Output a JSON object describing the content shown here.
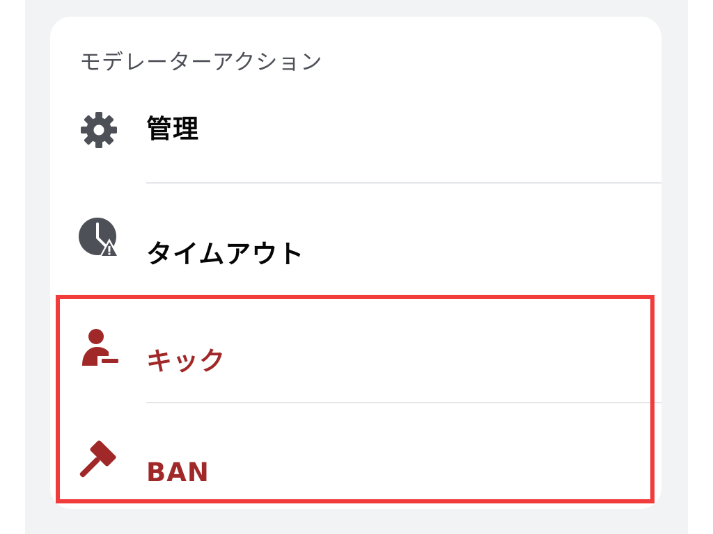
{
  "section": {
    "title": "モデレーターアクション"
  },
  "menu": {
    "items": [
      {
        "label": "管理",
        "icon": "gear-icon",
        "danger": false
      },
      {
        "label": "タイムアウト",
        "icon": "timeout-clock-icon",
        "danger": false
      },
      {
        "label": "キック",
        "icon": "kick-user-icon",
        "danger": true
      },
      {
        "label": "BAN",
        "icon": "ban-hammer-icon",
        "danger": true
      }
    ]
  },
  "colors": {
    "background": "#f2f3f5",
    "card": "#ffffff",
    "section_title": "#4e5058",
    "label": "#060607",
    "danger": "#a12828",
    "icon": "#4e5058",
    "separator": "#e3e5e8",
    "highlight": "#f23b3b"
  }
}
